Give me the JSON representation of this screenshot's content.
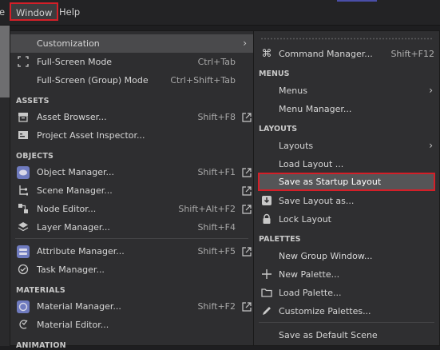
{
  "menubar": {
    "partial_item": "e",
    "window": "Window",
    "help": "Help"
  },
  "left_menu": {
    "customization": "Customization",
    "fullscreen": {
      "label": "Full-Screen Mode",
      "shortcut": "Ctrl+Tab"
    },
    "fullscreen_group": {
      "label": "Full-Screen (Group) Mode",
      "shortcut": "Ctrl+Shift+Tab"
    },
    "assets_header": "ASSETS",
    "asset_browser": {
      "label": "Asset Browser...",
      "shortcut": "Shift+F8"
    },
    "project_asset_inspector": {
      "label": "Project Asset Inspector..."
    },
    "objects_header": "OBJECTS",
    "object_manager": {
      "label": "Object Manager...",
      "shortcut": "Shift+F1"
    },
    "scene_manager": {
      "label": "Scene Manager..."
    },
    "node_editor": {
      "label": "Node Editor...",
      "shortcut": "Shift+Alt+F2"
    },
    "layer_manager": {
      "label": "Layer Manager...",
      "shortcut": "Shift+F4"
    },
    "attribute_manager": {
      "label": "Attribute Manager...",
      "shortcut": "Shift+F5"
    },
    "task_manager": {
      "label": "Task Manager..."
    },
    "materials_header": "MATERIALS",
    "material_manager": {
      "label": "Material Manager...",
      "shortcut": "Shift+F2"
    },
    "material_editor": {
      "label": "Material Editor..."
    },
    "animation_header": "ANIMATION"
  },
  "right_menu": {
    "command_manager": {
      "label": "Command Manager...",
      "shortcut": "Shift+F12"
    },
    "menus_header": "MENUS",
    "menus": "Menus",
    "menu_manager": "Menu Manager...",
    "layouts_header": "LAYOUTS",
    "layouts": "Layouts",
    "load_layout": "Load Layout ...",
    "save_startup": "Save as Startup Layout",
    "save_layout_as": "Save Layout as...",
    "lock_layout": "Lock Layout",
    "palettes_header": "PALETTES",
    "new_group_window": "New Group Window...",
    "new_palette": "New Palette...",
    "load_palette": "Load Palette...",
    "customize_palettes": "Customize Palettes...",
    "save_default_scene": "Save as Default Scene"
  },
  "colors": {
    "highlight_border": "#d41f28",
    "menu_bg": "#2e2e30",
    "hover": "#4a4a4c"
  }
}
